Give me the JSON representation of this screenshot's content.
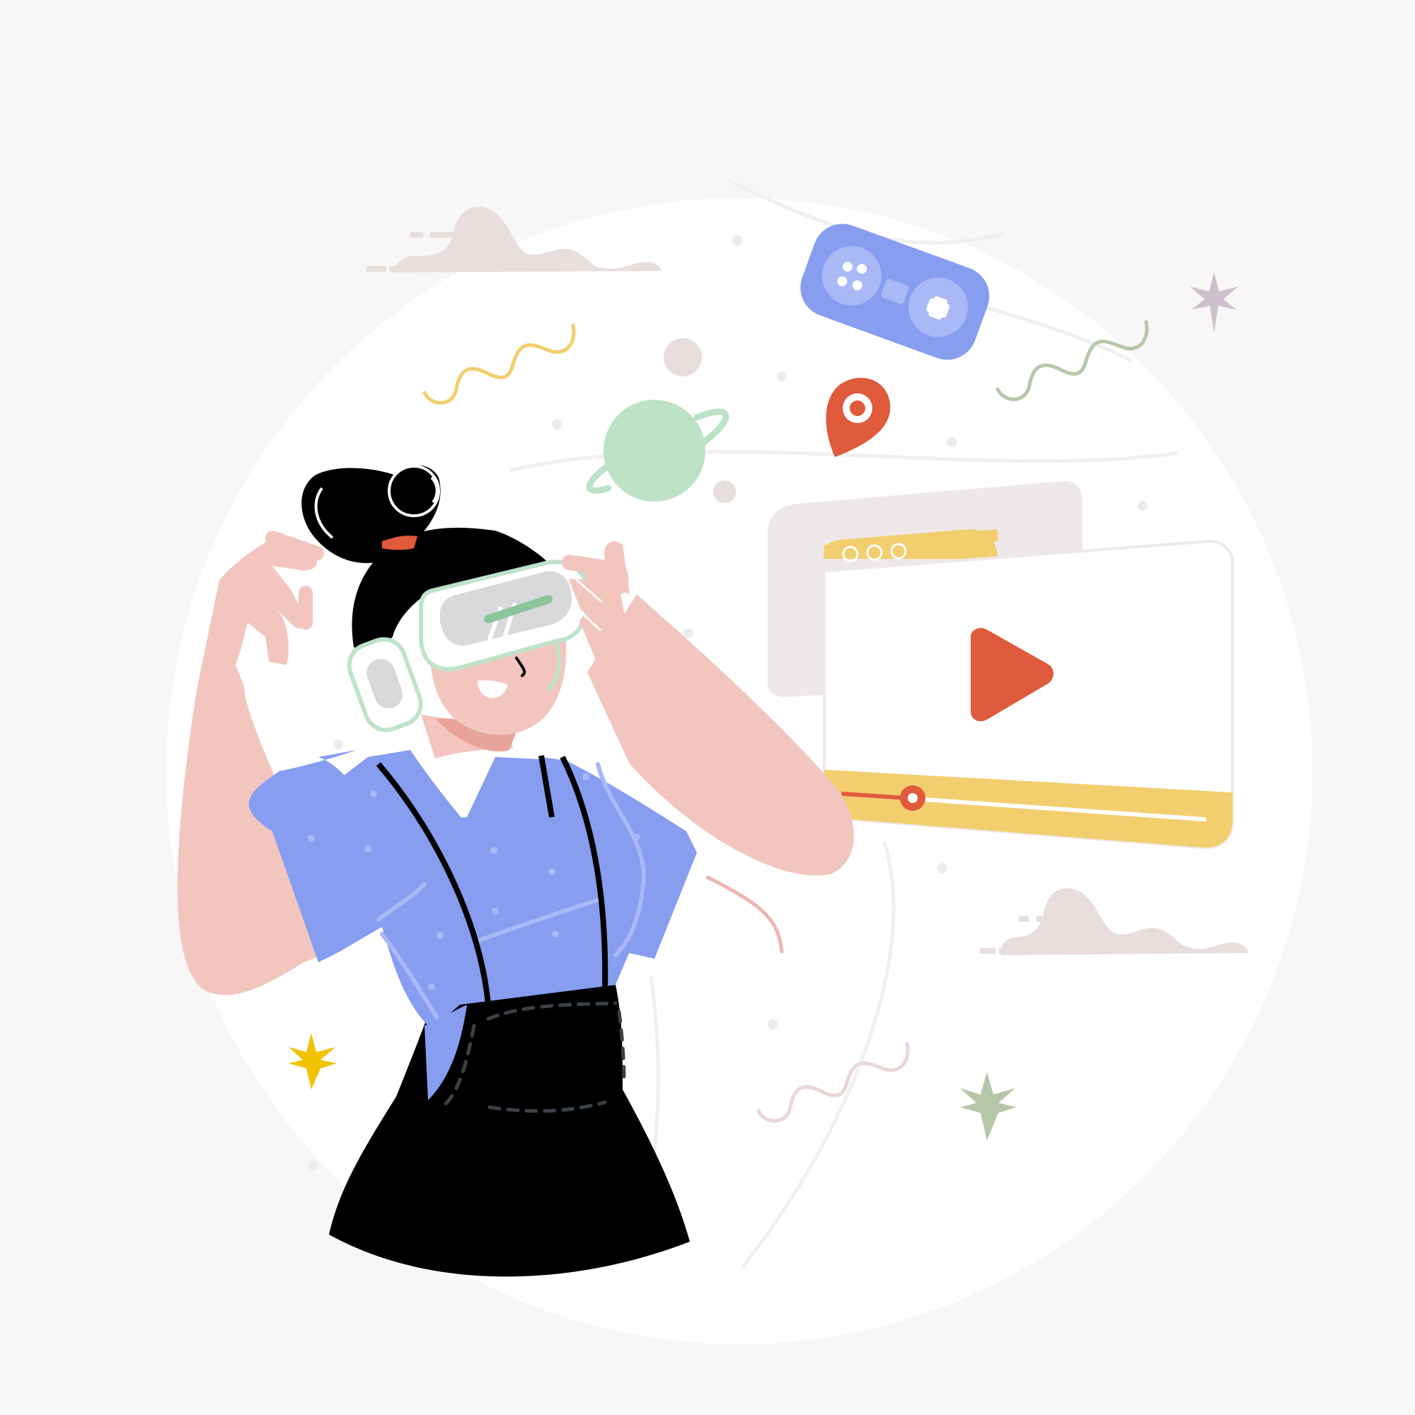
{
  "illustration": {
    "subject": "woman-wearing-vr-headset",
    "icons": [
      "gamepad-icon",
      "location-pin-icon",
      "planet-icon",
      "video-player-icon",
      "play-icon",
      "cloud-icon",
      "star-icon",
      "squiggle-icon"
    ]
  },
  "colors": {
    "background": "#f8f6f7",
    "backdrop_circle": "#ffffff",
    "skin": "#f2c6bf",
    "skin_shadow": "#e8a49a",
    "hair": "#000000",
    "shirt": "#869df0",
    "shirt_light": "#a8b9f6",
    "overalls": "#000000",
    "headset": "#ffffff",
    "headset_outline": "#bfe3c8",
    "lens": "#d9d9db",
    "lens_bar": "#8cc49c",
    "gamepad": "#869df0",
    "gamepad_light": "#a8b9f6",
    "pin": "#e05a3c",
    "planet": "#bde2c6",
    "player_bar": "#f2ce6e",
    "player_back": "#eee8e8",
    "play_button": "#e05a3c",
    "cloud": "#e8dedd",
    "star_yellow": "#f2c200",
    "star_green": "#b5c7a8",
    "star_mauve": "#cdbfcb",
    "squiggle_yellow": "#f2ce6e",
    "squiggle_green": "#b5c7a8",
    "squiggle_pink": "#ead7d6"
  }
}
